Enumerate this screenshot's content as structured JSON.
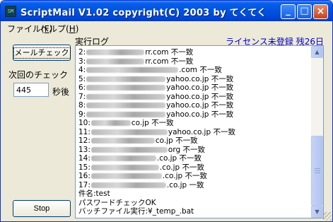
{
  "window": {
    "title": "ScriptMail V1.02 copyright(C) 2003 by てくてく",
    "icon_text": "SM"
  },
  "titlebar_buttons": {
    "minimize": "_",
    "maximize": "□",
    "close": "×"
  },
  "menu": [
    {
      "label": "ファイル",
      "accel": "F"
    },
    {
      "label": "ヘルプ",
      "accel": "H"
    }
  ],
  "left_panel": {
    "mail_check_label": "メールチェック",
    "next_check_label": "次回のチェック",
    "seconds_value": "445",
    "seconds_unit": "秒後",
    "stop_label": "Stop"
  },
  "log": {
    "label": "実行ログ",
    "license_text": "ライセンス未登録 残26日",
    "lines": [
      {
        "prefix": "2:",
        "suffix": "rr.com 不一致"
      },
      {
        "prefix": "3:",
        "suffix": "rr.com 不一致"
      },
      {
        "prefix": "4:",
        "suffix": ".com 不一致"
      },
      {
        "prefix": "5:",
        "suffix": "yahoo.co.jp 不一致"
      },
      {
        "prefix": "6:",
        "suffix": "yahoo.co.jp 不一致"
      },
      {
        "prefix": "7:",
        "suffix": "yahoo.co.jp 不一致"
      },
      {
        "prefix": "8:",
        "suffix": "yahoo.co.jp 不一致"
      },
      {
        "prefix": "9:",
        "suffix": "yahoo.co.jp 不一致"
      },
      {
        "prefix": "10:",
        "suffix": "co.jp 不一致"
      },
      {
        "prefix": "11:",
        "suffix": "yahoo.co.jp 不一致"
      },
      {
        "prefix": "12:",
        "suffix": "co.jp 不一致"
      },
      {
        "prefix": "13:",
        "suffix": "org 不一致"
      },
      {
        "prefix": "14:",
        "suffix": ".co.jp 不一致"
      },
      {
        "prefix": "15:",
        "suffix": ".co.jp 不一致"
      },
      {
        "prefix": "16:",
        "suffix": ".co.jp 不一致"
      },
      {
        "prefix": "17:",
        "suffix": ".co.jp 一致"
      },
      {
        "prefix": "件名:test",
        "suffix": ""
      },
      {
        "prefix": "パスワードチェックOK",
        "suffix": ""
      },
      {
        "prefix": "バッチファイル実行:¥_temp_.bat",
        "suffix": ""
      }
    ]
  },
  "colors": {
    "title_bar": "#0054e3",
    "license_text": "#0000c0",
    "face": "#ece9d8"
  }
}
